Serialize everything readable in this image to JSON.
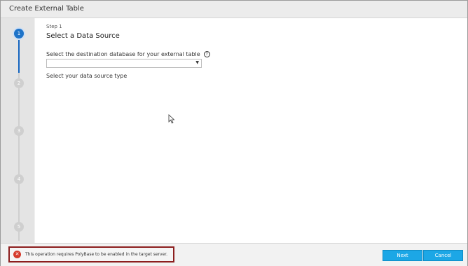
{
  "window": {
    "title": "Create External Table"
  },
  "stepper": {
    "steps": [
      "1",
      "2",
      "3",
      "4",
      "5"
    ],
    "active_step": "1"
  },
  "main": {
    "step_label": "Step 1",
    "heading": "Select a Data Source",
    "database_label": "Select the destination database for your external table",
    "database_select": {
      "value": ""
    },
    "source_type_label": "Select your data source type"
  },
  "footer": {
    "error_message": "This operation requires PolyBase to be enabled in the target server.",
    "next_label": "Next",
    "cancel_label": "Cancel"
  },
  "colors": {
    "accent": "#1e73c8",
    "button": "#1ca7e6",
    "error": "#d53a2b",
    "error_border": "#8c1e1e"
  },
  "icons": [
    "help-icon",
    "error-icon",
    "dropdown-arrow-icon",
    "mouse-cursor-icon"
  ]
}
